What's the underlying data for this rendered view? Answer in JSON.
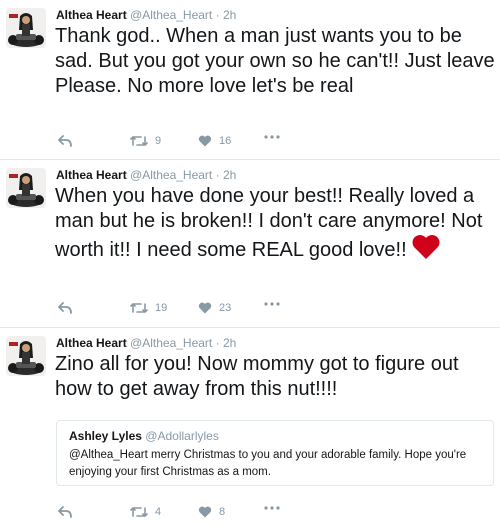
{
  "tweets": [
    {
      "name": "Althea Heart",
      "handle": "@Althea_Heart",
      "separator": "·",
      "time": "2h",
      "text": "Thank god.. When a man just wants you to be sad. But you got your own so he can't!! Just leave   Please. No more love let's be real",
      "retweets": "9",
      "likes": "16"
    },
    {
      "name": "Althea Heart",
      "handle": "@Althea_Heart",
      "separator": "·",
      "time": "2h",
      "text": "When you have done your best!!  Really loved a man but he is broken!! I don't care anymore! Not worth it!! I need some REAL good love!!",
      "retweets": "19",
      "likes": "23"
    },
    {
      "name": "Althea Heart",
      "handle": "@Althea_Heart",
      "separator": "·",
      "time": "2h",
      "text": "Zino all for you! Now mommy got to figure out how to get away from this nut!!!!",
      "retweets": "4",
      "likes": "8",
      "quote": {
        "name": "Ashley Lyles",
        "handle": "@Adollarlyles",
        "text": "@Althea_Heart merry Christmas to you and your adorable family. Hope you're enjoying your first Christmas as a mom."
      }
    }
  ],
  "colors": {
    "text": "#14171a",
    "muted": "#8899a6",
    "border": "#e1e8ed",
    "heart_emoji": "#d0021b"
  }
}
